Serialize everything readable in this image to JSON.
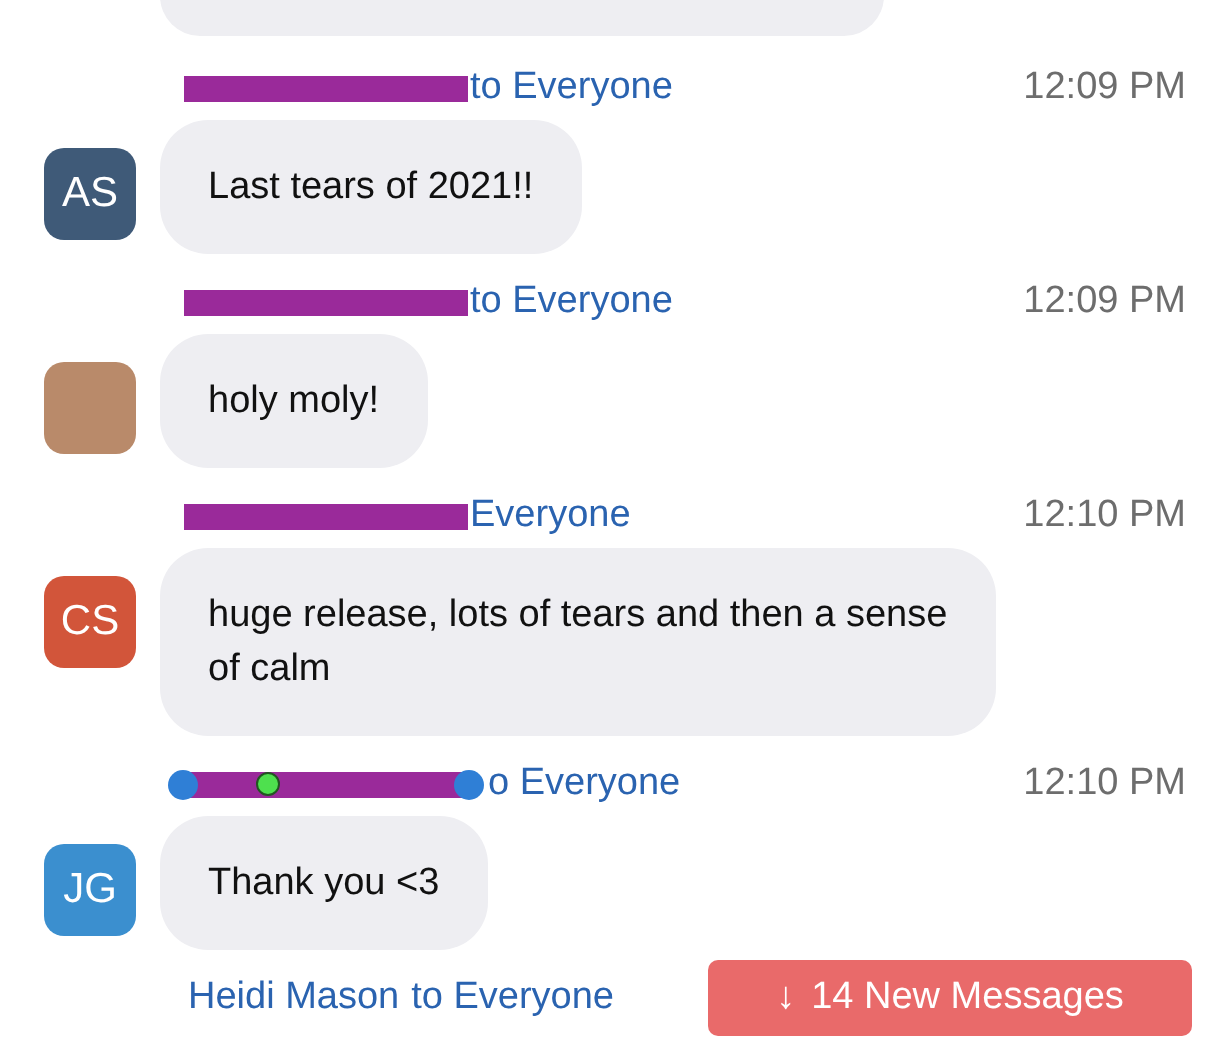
{
  "messages": [
    {
      "redacted": true,
      "handles": false,
      "recipient": "to Everyone",
      "time": "12:09 PM",
      "avatar": {
        "kind": "initials",
        "initials": "AS",
        "color": "#3f5a78"
      },
      "text": "Last tears of 2021!!"
    },
    {
      "redacted": true,
      "handles": false,
      "recipient": "to Everyone",
      "time": "12:09 PM",
      "avatar": {
        "kind": "photo"
      },
      "text": "holy moly!"
    },
    {
      "redacted": true,
      "handles": false,
      "recipient": "Everyone",
      "time": "12:10 PM",
      "avatar": {
        "kind": "initials",
        "initials": "CS",
        "color": "#d2553a"
      },
      "text": "huge release, lots of tears and then a sense of calm"
    },
    {
      "redacted": true,
      "handles": true,
      "recipient": "o Everyone",
      "time": "12:10 PM",
      "avatar": {
        "kind": "initials",
        "initials": "JG",
        "color": "#3b8fcf"
      },
      "text": "Thank you <3"
    }
  ],
  "last_header": {
    "sender": "Heidi Mason",
    "recipient": "to Everyone"
  },
  "new_messages_button": {
    "arrow": "↓",
    "label": "14 New Messages"
  }
}
